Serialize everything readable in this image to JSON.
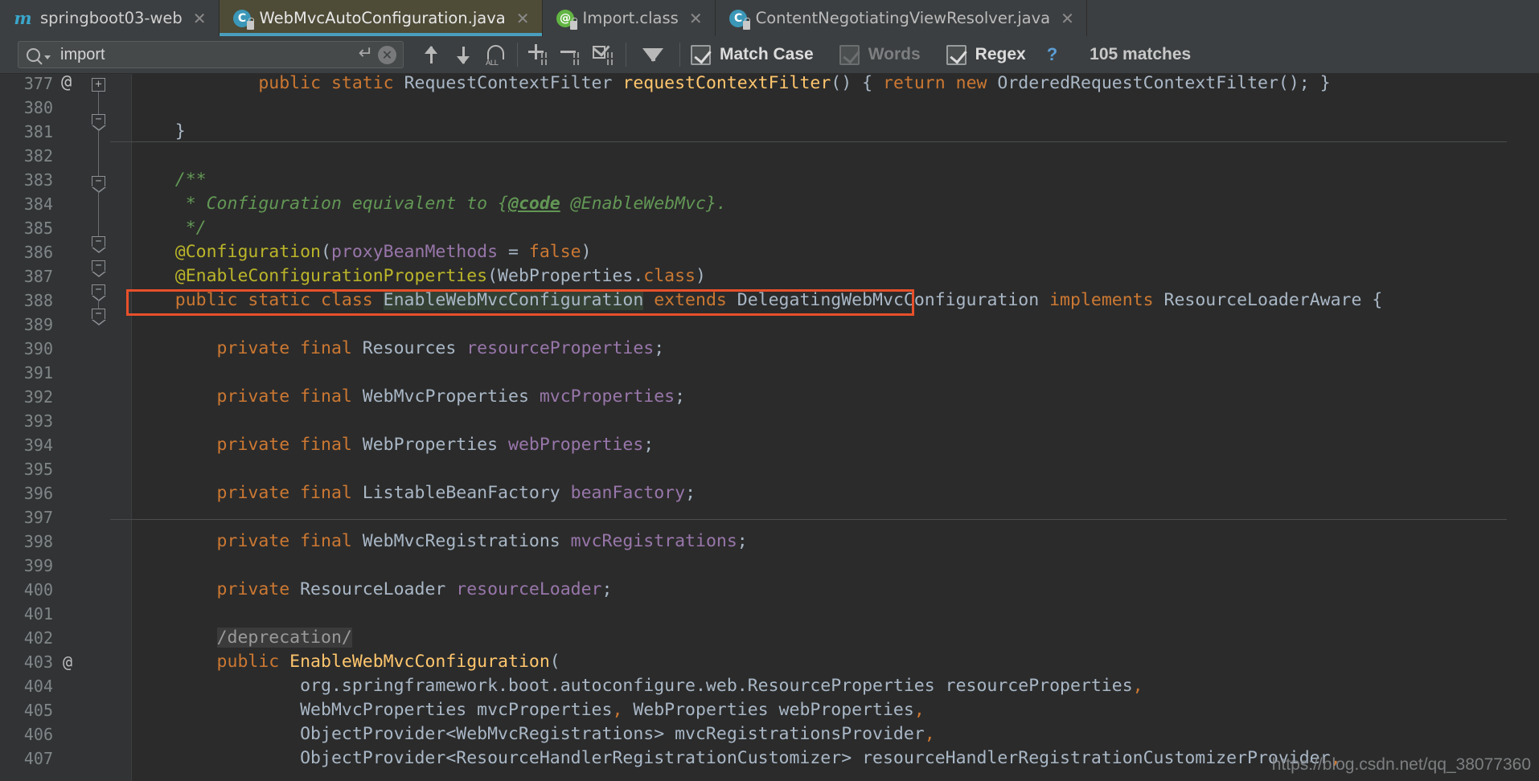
{
  "window": {
    "theme_background": "#2b2b2b",
    "accent": "#4a9ebd"
  },
  "tabs": [
    {
      "label": "springboot03-web",
      "icon": "maven-module-icon",
      "active": false,
      "closable": true,
      "locked": false
    },
    {
      "label": "WebMvcAutoConfiguration.java",
      "icon": "java-class-icon",
      "active": true,
      "closable": true,
      "locked": true
    },
    {
      "label": "Import.class",
      "icon": "java-annotation-icon",
      "active": false,
      "closable": true,
      "locked": true
    },
    {
      "label": "ContentNegotiatingViewResolver.java",
      "icon": "java-class-icon",
      "active": false,
      "closable": true,
      "locked": true
    }
  ],
  "find_toolbar": {
    "search_value": "import",
    "search_placeholder": "Search",
    "icons": {
      "search": "search-icon",
      "history_dropdown": "chevron-down-icon",
      "multiline": "enter-icon",
      "clear": "clear-icon",
      "prev": "arrow-up-icon",
      "next": "arrow-down-icon",
      "select_all": "select-all-occurrences-icon",
      "add_line": "add-selection-icon",
      "remove_line": "remove-selection-icon",
      "select_all_lines": "select-all-lines-icon",
      "filter": "filter-icon",
      "help": "help-icon"
    },
    "options": [
      {
        "label": "Match Case",
        "checked": true,
        "enabled": true
      },
      {
        "label": "Words",
        "checked": true,
        "enabled": false
      },
      {
        "label": "Regex",
        "checked": true,
        "enabled": true
      }
    ],
    "help_label": "?",
    "match_count": "105 matches"
  },
  "editor": {
    "first_visible_line": 377,
    "highlight_box_color": "#e8502a",
    "lines": [
      {
        "num": "377",
        "partial": true,
        "tokens": [
          {
            "t": "            ",
            "c": "txt"
          },
          {
            "t": "public static ",
            "c": "kw"
          },
          {
            "t": "RequestContextFilter ",
            "c": "cls"
          },
          {
            "t": "requestContextFilter",
            "c": "mth"
          },
          {
            "t": "() { ",
            "c": "txt"
          },
          {
            "t": "return new ",
            "c": "kw"
          },
          {
            "t": "OrderedRequestContextFilter(); }",
            "c": "txt"
          }
        ]
      },
      {
        "num": "380",
        "tokens": []
      },
      {
        "num": "381",
        "tokens": [
          {
            "t": "    }",
            "c": "txt"
          }
        ]
      },
      {
        "num": "382",
        "tokens": []
      },
      {
        "num": "383",
        "tokens": [
          {
            "t": "    /**",
            "c": "cmt"
          }
        ]
      },
      {
        "num": "384",
        "tokens": [
          {
            "t": "     * Configuration equivalent to {",
            "c": "cmt"
          },
          {
            "t": "@code",
            "c": "cmtlink"
          },
          {
            "t": " @EnableWebMvc}.",
            "c": "cmt"
          }
        ]
      },
      {
        "num": "385",
        "tokens": [
          {
            "t": "     */",
            "c": "cmt"
          }
        ]
      },
      {
        "num": "386",
        "tokens": [
          {
            "t": "    @Configuration",
            "c": "anno"
          },
          {
            "t": "(",
            "c": "txt"
          },
          {
            "t": "proxyBeanMethods",
            "c": "fld"
          },
          {
            "t": " = ",
            "c": "txt"
          },
          {
            "t": "false",
            "c": "kw"
          },
          {
            "t": ")",
            "c": "txt"
          }
        ]
      },
      {
        "num": "387",
        "tokens": [
          {
            "t": "    @EnableConfigurationProperties",
            "c": "anno"
          },
          {
            "t": "(WebProperties.",
            "c": "txt"
          },
          {
            "t": "class",
            "c": "kw"
          },
          {
            "t": ")",
            "c": "txt"
          }
        ]
      },
      {
        "num": "388",
        "boxed": true,
        "tokens": [
          {
            "t": "    public static class ",
            "c": "kw"
          },
          {
            "t": "EnableWebMvcConfiguration",
            "c": "hl"
          },
          {
            "t": " extends ",
            "c": "kw"
          },
          {
            "t": "DelegatingWebMvcConfiguration ",
            "c": "txt"
          },
          {
            "t": "implements ",
            "c": "kw"
          },
          {
            "t": "ResourceLoaderAware {",
            "c": "txt"
          }
        ]
      },
      {
        "num": "389",
        "tokens": []
      },
      {
        "num": "390",
        "tokens": [
          {
            "t": "        private final ",
            "c": "kw"
          },
          {
            "t": "Resources ",
            "c": "cls"
          },
          {
            "t": "resourceProperties",
            "c": "fld"
          },
          {
            "t": ";",
            "c": "txt"
          }
        ]
      },
      {
        "num": "391",
        "tokens": []
      },
      {
        "num": "392",
        "tokens": [
          {
            "t": "        private final ",
            "c": "kw"
          },
          {
            "t": "WebMvcProperties ",
            "c": "cls"
          },
          {
            "t": "mvcProperties",
            "c": "fld"
          },
          {
            "t": ";",
            "c": "txt"
          }
        ]
      },
      {
        "num": "393",
        "tokens": []
      },
      {
        "num": "394",
        "tokens": [
          {
            "t": "        private final ",
            "c": "kw"
          },
          {
            "t": "WebProperties ",
            "c": "cls"
          },
          {
            "t": "webProperties",
            "c": "fld"
          },
          {
            "t": ";",
            "c": "txt"
          }
        ]
      },
      {
        "num": "395",
        "tokens": []
      },
      {
        "num": "396",
        "tokens": [
          {
            "t": "        private final ",
            "c": "kw"
          },
          {
            "t": "ListableBeanFactory ",
            "c": "cls"
          },
          {
            "t": "beanFactory",
            "c": "fld"
          },
          {
            "t": ";",
            "c": "txt"
          }
        ]
      },
      {
        "num": "397",
        "tokens": []
      },
      {
        "num": "398",
        "tokens": [
          {
            "t": "        private final ",
            "c": "kw"
          },
          {
            "t": "WebMvcRegistrations ",
            "c": "cls"
          },
          {
            "t": "mvcRegistrations",
            "c": "fld"
          },
          {
            "t": ";",
            "c": "txt"
          }
        ]
      },
      {
        "num": "399",
        "tokens": []
      },
      {
        "num": "400",
        "tokens": [
          {
            "t": "        private ",
            "c": "kw"
          },
          {
            "t": "ResourceLoader ",
            "c": "cls"
          },
          {
            "t": "resourceLoader",
            "c": "fld"
          },
          {
            "t": ";",
            "c": "txt"
          }
        ]
      },
      {
        "num": "401",
        "tokens": []
      },
      {
        "num": "402",
        "tokens": [
          {
            "t": "        ",
            "c": "txt"
          },
          {
            "t": "/deprecation/",
            "c": "depr"
          }
        ]
      },
      {
        "num": "403",
        "marker": "@",
        "tokens": [
          {
            "t": "        public ",
            "c": "kw"
          },
          {
            "t": "EnableWebMvcConfiguration",
            "c": "mth"
          },
          {
            "t": "(",
            "c": "txt"
          }
        ]
      },
      {
        "num": "404",
        "tokens": [
          {
            "t": "                org.springframework.boot.autoconfigure.web.ResourceProperties resourceProperties",
            "c": "txt"
          },
          {
            "t": ",",
            "c": "kw"
          }
        ]
      },
      {
        "num": "405",
        "tokens": [
          {
            "t": "                WebMvcProperties mvcProperties",
            "c": "txt"
          },
          {
            "t": ",",
            "c": "kw"
          },
          {
            "t": " WebProperties webProperties",
            "c": "txt"
          },
          {
            "t": ",",
            "c": "kw"
          }
        ]
      },
      {
        "num": "406",
        "tokens": [
          {
            "t": "                ObjectProvider<WebMvcRegistrations> mvcRegistrationsProvider",
            "c": "txt"
          },
          {
            "t": ",",
            "c": "kw"
          }
        ]
      },
      {
        "num": "407",
        "tokens": [
          {
            "t": "                ObjectProvider<ResourceHandlerRegistrationCustomizer> resourceHandlerRegistrationCustomizerProvider",
            "c": "txt"
          },
          {
            "t": ",",
            "c": "kw"
          }
        ]
      }
    ]
  },
  "watermark": "https://blog.csdn.net/qq_38077360"
}
